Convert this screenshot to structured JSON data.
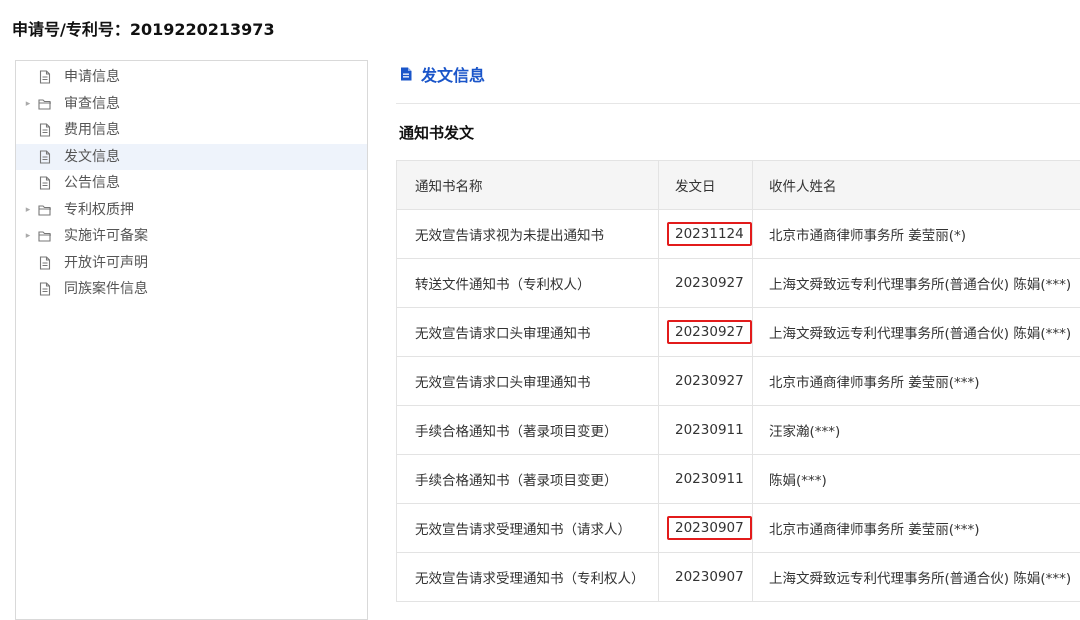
{
  "header": {
    "title": "申请号/专利号：2019220213973"
  },
  "sidebar": {
    "items": [
      {
        "label": "申请信息",
        "icon": "document-icon",
        "expandable": false,
        "active": false
      },
      {
        "label": "审查信息",
        "icon": "folder-icon",
        "expandable": true,
        "active": false
      },
      {
        "label": "费用信息",
        "icon": "document-icon",
        "expandable": false,
        "active": false
      },
      {
        "label": "发文信息",
        "icon": "document-icon",
        "expandable": false,
        "active": true
      },
      {
        "label": "公告信息",
        "icon": "document-icon",
        "expandable": false,
        "active": false
      },
      {
        "label": "专利权质押",
        "icon": "folder-icon",
        "expandable": true,
        "active": false
      },
      {
        "label": "实施许可备案",
        "icon": "folder-icon",
        "expandable": true,
        "active": false
      },
      {
        "label": "开放许可声明",
        "icon": "document-icon",
        "expandable": false,
        "active": false
      },
      {
        "label": "同族案件信息",
        "icon": "document-icon",
        "expandable": false,
        "active": false
      }
    ]
  },
  "main": {
    "section_title": "发文信息",
    "subsection_title": "通知书发文",
    "table": {
      "headers": [
        "通知书名称",
        "发文日",
        "收件人姓名"
      ],
      "rows": [
        {
          "name": "无效宣告请求视为未提出通知书",
          "date": "20231124",
          "recipient": "北京市通商律师事务所 姜莹丽(*)",
          "highlight": true
        },
        {
          "name": "转送文件通知书（专利权人）",
          "date": "20230927",
          "recipient": "上海文舜致远专利代理事务所(普通合伙) 陈娟(***)",
          "highlight": false
        },
        {
          "name": "无效宣告请求口头审理通知书",
          "date": "20230927",
          "recipient": "上海文舜致远专利代理事务所(普通合伙) 陈娟(***)",
          "highlight": true
        },
        {
          "name": "无效宣告请求口头审理通知书",
          "date": "20230927",
          "recipient": "北京市通商律师事务所 姜莹丽(***)",
          "highlight": false
        },
        {
          "name": "手续合格通知书（著录项目变更）",
          "date": "20230911",
          "recipient": "汪家瀚(***)",
          "highlight": false
        },
        {
          "name": "手续合格通知书（著录项目变更）",
          "date": "20230911",
          "recipient": "陈娟(***)",
          "highlight": false
        },
        {
          "name": "无效宣告请求受理通知书（请求人）",
          "date": "20230907",
          "recipient": "北京市通商律师事务所 姜莹丽(***)",
          "highlight": true
        },
        {
          "name": "无效宣告请求受理通知书（专利权人）",
          "date": "20230907",
          "recipient": "上海文舜致远专利代理事务所(普通合伙) 陈娟(***)",
          "highlight": false
        }
      ]
    }
  },
  "colors": {
    "accent_blue": "#1a55c9",
    "highlight_red": "#e21b1b",
    "active_row_bg": "#eef3fb",
    "header_bg": "#f5f5f5"
  }
}
